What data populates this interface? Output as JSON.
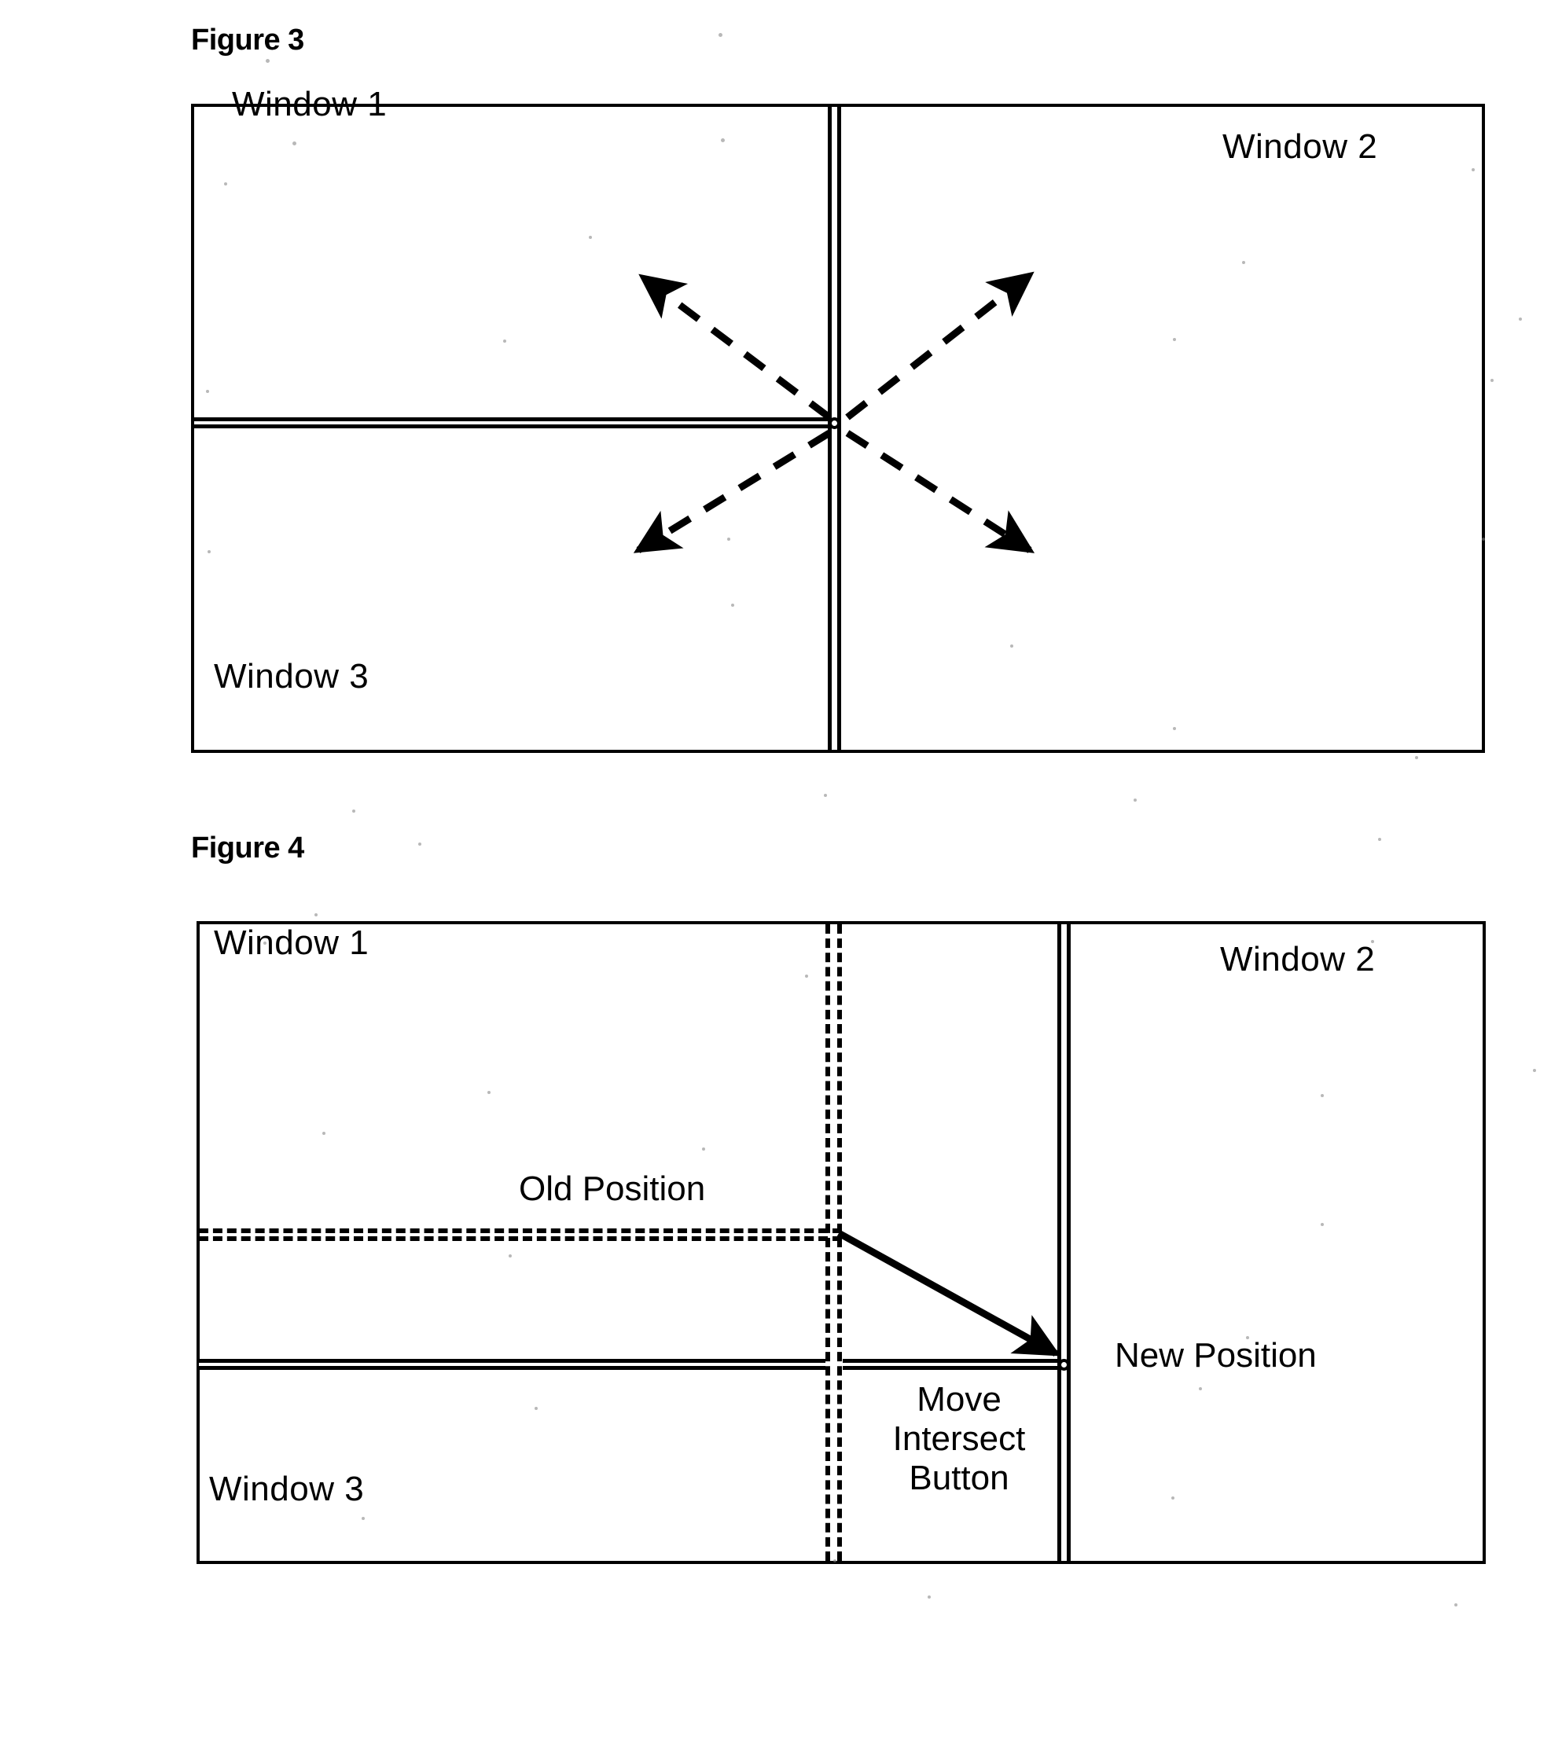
{
  "document": {
    "background_color": "#ffffff",
    "ink_color": "#000000"
  },
  "figures": [
    {
      "id": "figure-3",
      "caption": "Figure 3",
      "panes": [
        {
          "id": "window-1",
          "label": "Window 1"
        },
        {
          "id": "window-2",
          "label": "Window 2"
        },
        {
          "id": "window-3",
          "label": "Window 3"
        }
      ],
      "dividers": {
        "horizontal_style": "double-solid",
        "vertical_style": "double-solid"
      },
      "intersection": {
        "name": "intersect-handle",
        "style": "small-open-circle"
      },
      "arrows": {
        "style": "dashed-double-headed",
        "directions": [
          "up-left",
          "up-right",
          "down-left",
          "down-right"
        ],
        "count": 4
      }
    },
    {
      "id": "figure-4",
      "caption": "Figure 4",
      "panes": [
        {
          "id": "window-1",
          "label": "Window 1"
        },
        {
          "id": "window-2",
          "label": "Window 2"
        },
        {
          "id": "window-3",
          "label": "Window 3"
        }
      ],
      "annotations": [
        {
          "id": "old-position-label",
          "text": "Old Position"
        },
        {
          "id": "new-position-label",
          "text": "New Position"
        },
        {
          "id": "move-intersect-button-label",
          "lines": [
            "Move",
            "Intersect",
            "Button"
          ]
        }
      ],
      "dividers": {
        "old_horizontal_style": "double-dashed",
        "old_vertical_style": "double-dashed",
        "new_horizontal_style": "double-solid",
        "new_vertical_style": "double-solid"
      },
      "intersection": {
        "name": "intersect-handle",
        "style": "small-open-circle"
      },
      "arrow": {
        "style": "solid-single-headed",
        "from": "old-intersection",
        "to": "new-intersection"
      }
    }
  ]
}
